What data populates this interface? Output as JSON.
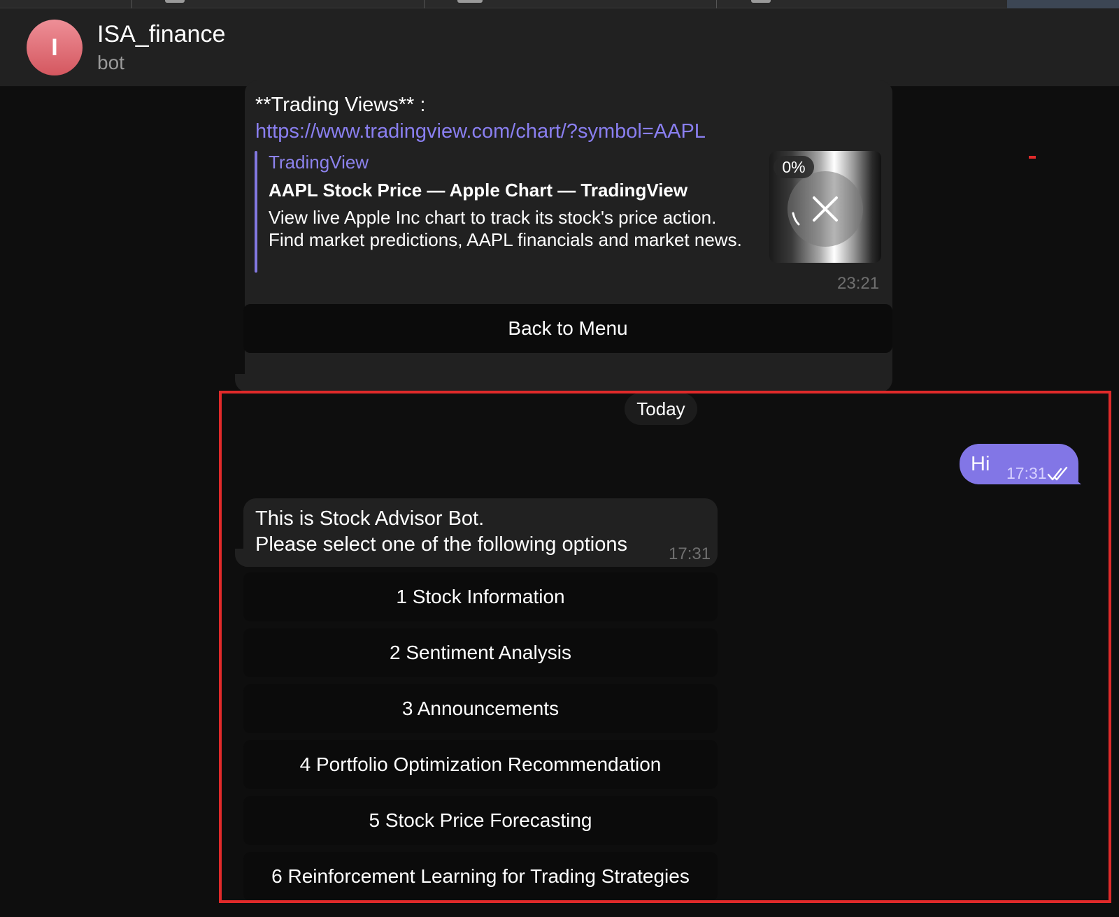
{
  "chat": {
    "title": "ISA_finance",
    "subtitle": "bot",
    "avatar_letter": "I",
    "avatar_color": "#e0737b"
  },
  "link_message": {
    "label": "**Trading Views** :",
    "url": "https://www.tradingview.com/chart/?symbol=AAPL",
    "preview": {
      "site": "TradingView",
      "title": "AAPL Stock Price — Apple Chart — TradingView",
      "description": "View live Apple Inc chart to track its stock's price action. Find market predictions, AAPL financials and market news.",
      "download_progress": "0%",
      "cancel_icon": "close-icon"
    },
    "time": "23:21",
    "button": "Back to Menu"
  },
  "date_separator": "Today",
  "outgoing": {
    "text": "Hi",
    "time": "17:31",
    "status_icon": "double-check-icon"
  },
  "bot_reply": {
    "line1": "This is Stock Advisor Bot.",
    "line2": "Please select one of the following options",
    "time": "17:31",
    "options": [
      "1 Stock Information",
      "2 Sentiment Analysis",
      "3 Announcements",
      "4 Portfolio Optimization Recommendation",
      "5 Stock Price Forecasting",
      "6 Reinforcement Learning for Trading Strategies"
    ]
  },
  "colors": {
    "accent": "#8276e6",
    "link": "#8a7ff0",
    "highlight_border": "#e02a2a",
    "bubble_in": "#212121",
    "background": "#0e0e0e"
  }
}
